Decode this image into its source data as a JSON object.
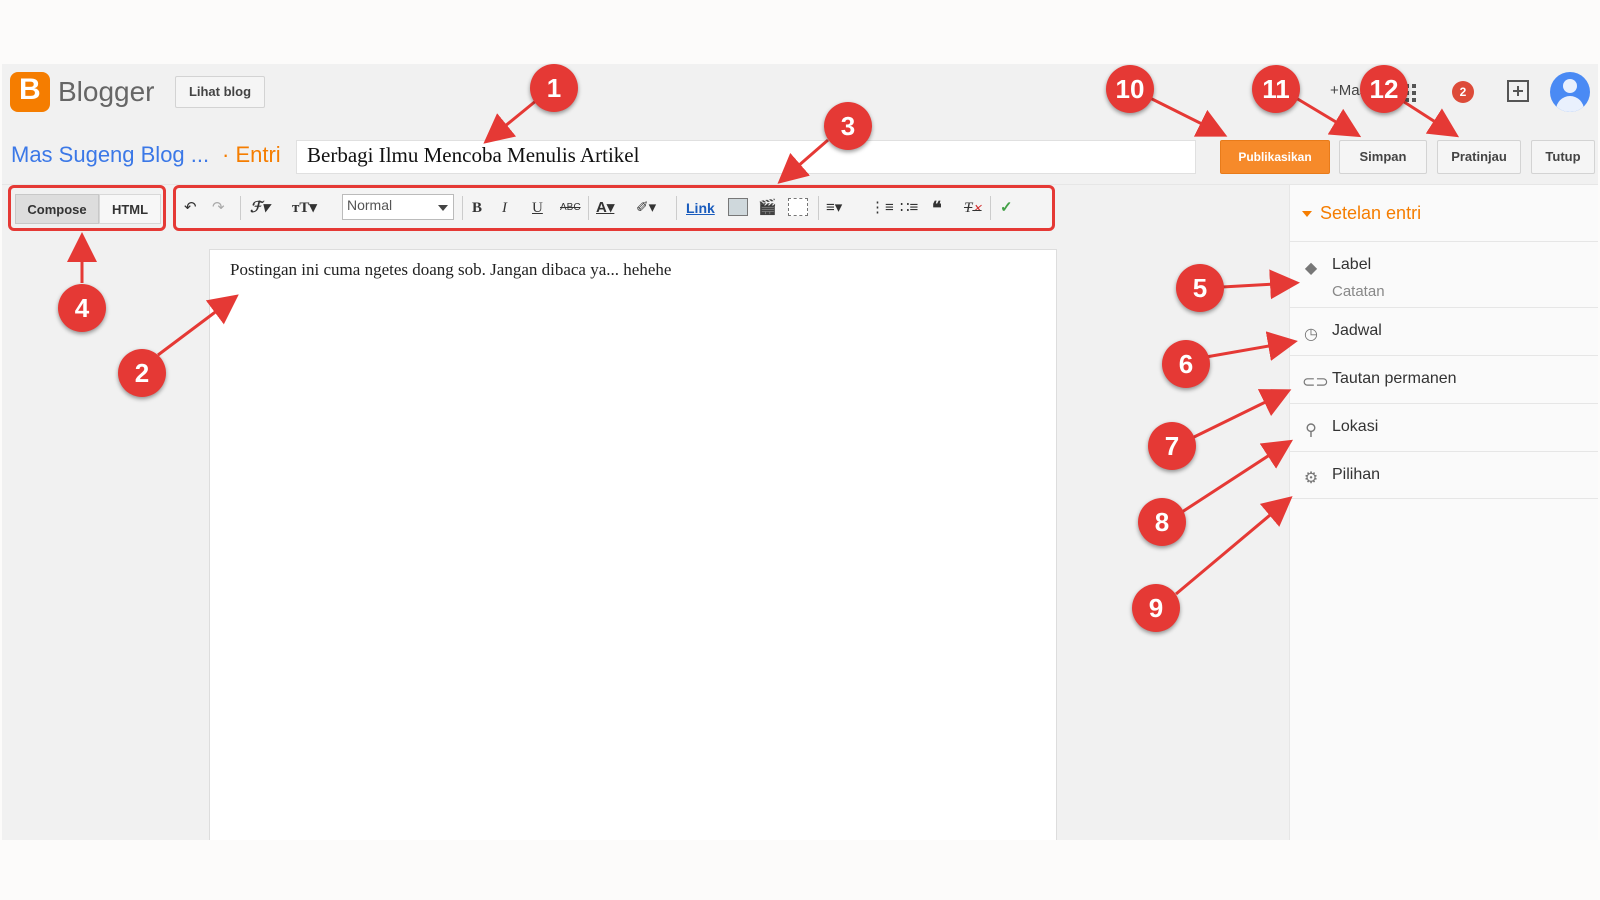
{
  "header": {
    "brand": "Blogger",
    "view_blog": "Lihat blog",
    "user": "+Mas",
    "notifications": "2"
  },
  "post": {
    "blog_name": "Mas Sugeng Blog ...",
    "section": "· Entri",
    "title": "Berbagi Ilmu Mencoba Menulis Artikel",
    "body": "Postingan ini cuma ngetes doang sob. Jangan dibaca ya... hehehe"
  },
  "actions": {
    "publish": "Publikasikan",
    "save": "Simpan",
    "preview": "Pratinjau",
    "close": "Tutup"
  },
  "modes": {
    "compose": "Compose",
    "html": "HTML"
  },
  "toolbar": {
    "format": "Normal",
    "link": "Link",
    "icons": [
      "undo-icon",
      "redo-icon",
      "font-family-icon",
      "font-size-icon",
      "bold-icon",
      "italic-icon",
      "underline-icon",
      "strikethrough-icon",
      "text-color-icon",
      "highlight-icon",
      "image-icon",
      "video-icon",
      "jump-break-icon",
      "align-icon",
      "numbered-list-icon",
      "bullet-list-icon",
      "quote-icon",
      "clear-format-icon",
      "spellcheck-icon"
    ]
  },
  "sidebar": {
    "title": "Setelan entri",
    "items": [
      {
        "label": "Label",
        "icon": "tag-icon",
        "note": "Catatan"
      },
      {
        "label": "Jadwal",
        "icon": "clock-icon"
      },
      {
        "label": "Tautan permanen",
        "icon": "link-icon"
      },
      {
        "label": "Lokasi",
        "icon": "location-icon"
      },
      {
        "label": "Pilihan",
        "icon": "gear-icon"
      }
    ]
  },
  "callouts": [
    "1",
    "2",
    "3",
    "4",
    "5",
    "6",
    "7",
    "8",
    "9",
    "10",
    "11",
    "12"
  ],
  "colors": {
    "accent": "#f57d00",
    "publish": "#f68a2a",
    "callout": "#e53935",
    "link": "#3b78e7"
  }
}
